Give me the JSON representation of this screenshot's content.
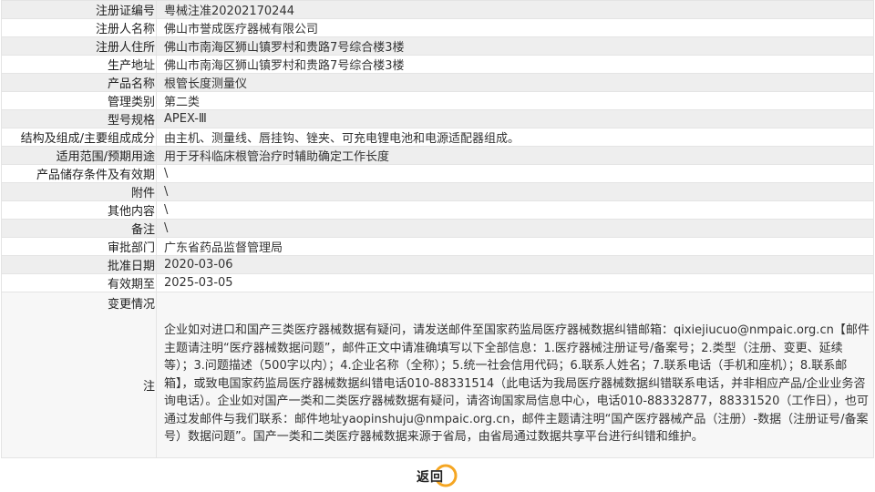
{
  "rows": [
    {
      "label": "注册证编号",
      "value": "粤械注准20202170244"
    },
    {
      "label": "注册人名称",
      "value": "佛山市誉成医疗器械有限公司"
    },
    {
      "label": "注册人住所",
      "value": "佛山市南海区狮山镇罗村和贵路7号综合楼3楼"
    },
    {
      "label": "生产地址",
      "value": "佛山市南海区狮山镇罗村和贵路7号综合楼3楼"
    },
    {
      "label": "产品名称",
      "value": "根管长度测量仪"
    },
    {
      "label": "管理类别",
      "value": "第二类"
    },
    {
      "label": "型号规格",
      "value": "APEX-Ⅲ"
    },
    {
      "label": "结构及组成/主要组成成分",
      "value": "由主机、测量线、唇挂钩、锉夹、可充电锂电池和电源适配器组成。"
    },
    {
      "label": "适用范围/预期用途",
      "value": "用于牙科临床根管治疗时辅助确定工作长度"
    },
    {
      "label": "产品储存条件及有效期",
      "value": "\\"
    },
    {
      "label": "附件",
      "value": "\\"
    },
    {
      "label": "其他内容",
      "value": "\\"
    },
    {
      "label": "备注",
      "value": "\\"
    },
    {
      "label": "审批部门",
      "value": "广东省药品监督管理局"
    },
    {
      "label": "批准日期",
      "value": "2020-03-06"
    },
    {
      "label": "有效期至",
      "value": "2025-03-05"
    },
    {
      "label": "变更情况",
      "value": ""
    }
  ],
  "note": {
    "label": "注",
    "text": "企业如对进口和国产三类医疗器械数据有疑问，请发送邮件至国家药监局医疗器械数据纠错邮箱：qixiejiucuo@nmpaic.org.cn【邮件主题请注明“医疗器械数据问题”，邮件正文中请准确填写以下全部信息：1.医疗器械注册证号/备案号；2.类型（注册、变更、延续等）；3.问题描述（500字以内）；4.企业名称（全称）；5.统一社会信用代码；6.联系人姓名；7.联系电话（手机和座机）；8.联系邮箱】，或致电国家药监局医疗器械数据纠错电话010-88331514（此电话为我局医疗器械数据纠错联系电话，并非相应产品/企业业务咨询电话）。企业如对国产一类和二类医疗器械数据有疑问，请咨询国家局信息中心，电话010-88332877，88331520（工作日），也可通过发邮件与我们联系：邮件地址yaopinshuju@nmpaic.org.cn，邮件主题请注明“国产医疗器械产品（注册）-数据（注册证号/备案号）数据问题”。国产一类和二类医疗器械数据来源于省局，由省局通过数据共享平台进行纠错和维护。"
  },
  "back_button": {
    "label": "返回",
    "icon": "return-circle-icon",
    "accent": "#f5a623"
  }
}
